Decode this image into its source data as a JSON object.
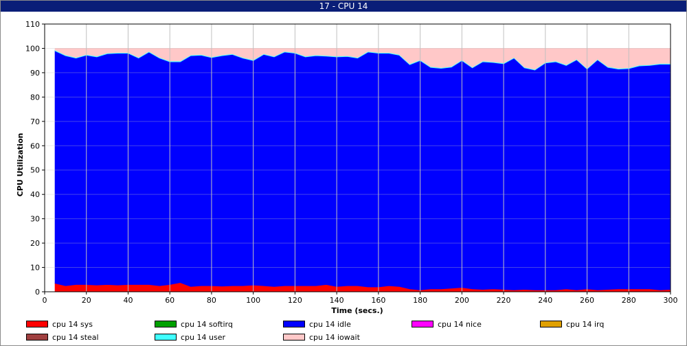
{
  "window": {
    "title": "17 - CPU 14"
  },
  "chart_data": {
    "type": "area",
    "title": "",
    "xlabel": "Time (secs.)",
    "ylabel": "CPU Utilization",
    "xlim": [
      0,
      300
    ],
    "ylim": [
      0,
      110
    ],
    "x_ticks": [
      0,
      20,
      40,
      60,
      80,
      100,
      120,
      140,
      160,
      180,
      200,
      220,
      240,
      260,
      280,
      300
    ],
    "y_ticks": [
      0,
      10,
      20,
      30,
      40,
      50,
      60,
      70,
      80,
      90,
      100,
      110
    ],
    "grid": true,
    "stacked": true,
    "legend_position": "bottom",
    "x": [
      5,
      10,
      15,
      20,
      25,
      30,
      35,
      40,
      45,
      50,
      55,
      60,
      65,
      70,
      75,
      80,
      85,
      90,
      95,
      100,
      105,
      110,
      115,
      120,
      125,
      130,
      135,
      140,
      145,
      150,
      155,
      160,
      165,
      170,
      175,
      180,
      185,
      190,
      195,
      200,
      205,
      210,
      215,
      220,
      225,
      230,
      235,
      240,
      245,
      250,
      255,
      260,
      265,
      270,
      275,
      280,
      285,
      290,
      295,
      300
    ],
    "series": [
      {
        "name": "cpu 14 sys",
        "color": "#ff0000",
        "values": [
          3.5,
          2.5,
          3,
          3,
          2.8,
          3,
          2.8,
          3,
          3,
          3,
          2.5,
          3,
          3.8,
          2.2,
          2.5,
          2.5,
          2.3,
          2.5,
          2.5,
          2.8,
          2.5,
          2.2,
          2.5,
          2.5,
          2.5,
          2.5,
          3,
          2.2,
          2.5,
          2.5,
          2,
          2,
          2.5,
          2.2,
          1.2,
          0.8,
          1.2,
          1.2,
          1.5,
          1.8,
          1.2,
          1,
          1.2,
          1,
          0.8,
          1,
          0.8,
          0.8,
          0.8,
          1.2,
          0.8,
          1.2,
          0.8,
          1,
          1.2,
          1.2,
          1.2,
          1.2,
          0.8,
          1
        ]
      },
      {
        "name": "cpu 14 softirq",
        "color": "#00a000",
        "values": [
          0,
          0,
          0,
          0,
          0,
          0,
          0,
          0,
          0,
          0,
          0,
          0,
          0,
          0,
          0,
          0,
          0,
          0,
          0,
          0,
          0,
          0,
          0,
          0,
          0,
          0,
          0,
          0,
          0,
          0,
          0,
          0,
          0,
          0,
          0,
          0,
          0,
          0,
          0,
          0,
          0,
          0,
          0,
          0,
          0,
          0,
          0,
          0,
          0,
          0,
          0,
          0,
          0,
          0,
          0,
          0,
          0,
          0,
          0,
          0
        ]
      },
      {
        "name": "cpu 14 idle",
        "color": "#0000ff",
        "values": [
          95.5,
          94.5,
          93,
          94.2,
          93.7,
          94.8,
          95.2,
          95,
          93,
          95.5,
          93.5,
          91.5,
          90.7,
          94.8,
          94.7,
          93.7,
          94.7,
          95,
          93.5,
          92.2,
          95,
          94.3,
          96,
          95.5,
          94,
          94.5,
          93.8,
          94.3,
          94.2,
          93.5,
          96.5,
          96,
          95.5,
          95,
          92.1,
          94.2,
          91,
          90.6,
          90.8,
          93.2,
          90.8,
          93.5,
          93,
          92.7,
          95.2,
          91,
          90.3,
          93.2,
          93.7,
          91.8,
          94.5,
          90.3,
          94.5,
          91.2,
          90.3,
          90.5,
          91.6,
          91.8,
          92.7,
          92.5
        ]
      },
      {
        "name": "cpu 14 nice",
        "color": "#ff00ff",
        "values": [
          0,
          0,
          0,
          0,
          0,
          0,
          0,
          0,
          0,
          0,
          0,
          0,
          0,
          0,
          0,
          0,
          0,
          0,
          0,
          0,
          0,
          0,
          0,
          0,
          0,
          0,
          0,
          0,
          0,
          0,
          0,
          0,
          0,
          0,
          0,
          0,
          0,
          0,
          0,
          0,
          0,
          0,
          0,
          0,
          0,
          0,
          0,
          0,
          0,
          0,
          0,
          0,
          0,
          0,
          0,
          0,
          0,
          0,
          0,
          0
        ]
      },
      {
        "name": "cpu 14 irq",
        "color": "#e0a000",
        "values": [
          0,
          0,
          0,
          0,
          0,
          0,
          0,
          0,
          0,
          0,
          0,
          0,
          0,
          0,
          0,
          0,
          0,
          0,
          0,
          0,
          0,
          0,
          0,
          0,
          0,
          0,
          0,
          0,
          0,
          0,
          0,
          0,
          0,
          0,
          0,
          0,
          0,
          0,
          0,
          0,
          0,
          0,
          0,
          0,
          0,
          0,
          0,
          0,
          0,
          0,
          0,
          0,
          0,
          0,
          0,
          0,
          0,
          0,
          0,
          0
        ]
      },
      {
        "name": "cpu 14 steal",
        "color": "#a04040",
        "values": [
          0,
          0,
          0,
          0,
          0,
          0,
          0,
          0,
          0,
          0,
          0,
          0,
          0,
          0,
          0,
          0,
          0,
          0,
          0,
          0,
          0,
          0,
          0,
          0,
          0,
          0,
          0,
          0,
          0,
          0,
          0,
          0,
          0,
          0,
          0,
          0,
          0,
          0,
          0,
          0,
          0,
          0,
          0,
          0,
          0,
          0,
          0,
          0,
          0,
          0,
          0,
          0,
          0,
          0,
          0,
          0,
          0,
          0,
          0,
          0
        ]
      },
      {
        "name": "cpu 14 user",
        "color": "#40ffff",
        "values": [
          0.3,
          0.3,
          0.3,
          0.3,
          0.3,
          0.3,
          0.3,
          0.3,
          0.3,
          0.3,
          0.3,
          0.3,
          0.3,
          0.3,
          0.3,
          0.3,
          0.3,
          0.3,
          0.3,
          0.3,
          0.3,
          0.3,
          0.3,
          0.3,
          0.3,
          0.3,
          0.3,
          0.3,
          0.3,
          0.3,
          0.3,
          0.3,
          0.3,
          0.3,
          0.3,
          0.3,
          0.3,
          0.3,
          0.3,
          0.3,
          0.3,
          0.3,
          0.3,
          0.3,
          0.3,
          0.3,
          0.3,
          0.3,
          0.3,
          0.3,
          0.3,
          0.3,
          0.3,
          0.3,
          0.3,
          0.3,
          0.3,
          0.3,
          0.3,
          0.3
        ]
      },
      {
        "name": "cpu 14 iowait",
        "color": "#ffc8c8",
        "values": [
          0.7,
          2.7,
          3.7,
          2.5,
          3.2,
          1.9,
          1.7,
          1.7,
          3.7,
          1.2,
          3.7,
          5.2,
          5.2,
          2.7,
          2.5,
          3.5,
          2.7,
          2.2,
          3.7,
          4.7,
          2.2,
          3.2,
          1.2,
          1.7,
          3.2,
          2.7,
          2.9,
          3.2,
          3,
          3.7,
          1.2,
          1.7,
          1.7,
          2.5,
          6.4,
          4.7,
          7.5,
          7.9,
          7.4,
          4.7,
          7.7,
          5.2,
          5.5,
          6,
          3.7,
          7.7,
          8.6,
          5.7,
          5.2,
          6.7,
          4.4,
          8.2,
          4.4,
          7.5,
          8.2,
          8,
          6.9,
          6.7,
          6.2,
          6.2
        ]
      }
    ]
  }
}
